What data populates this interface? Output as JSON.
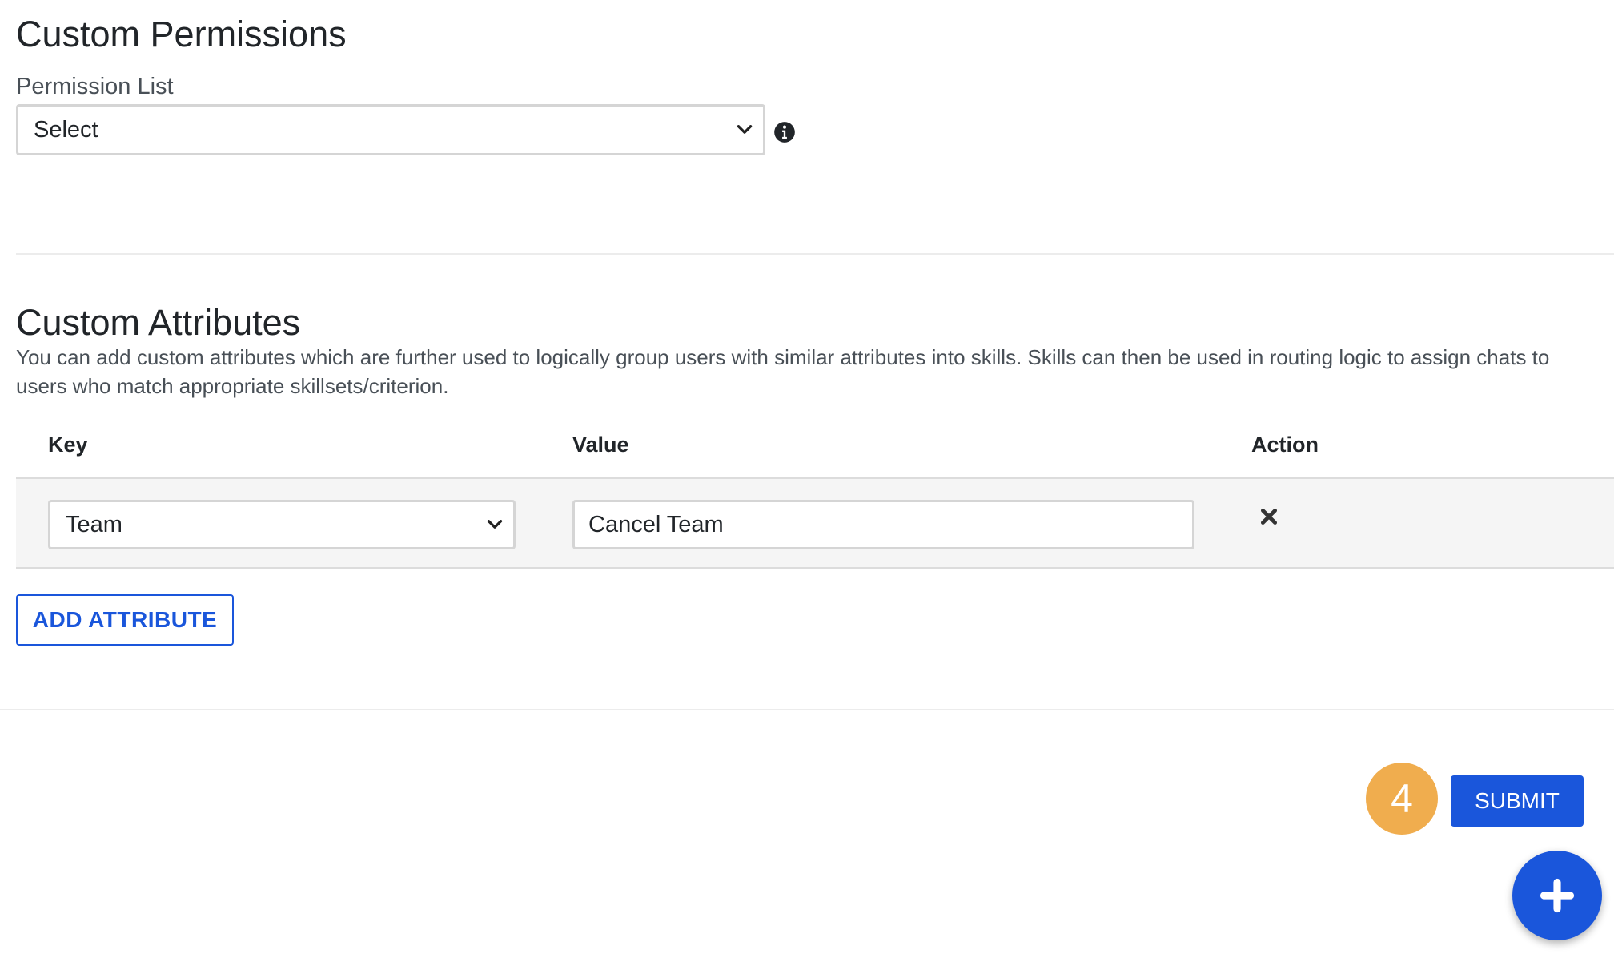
{
  "custom_permissions": {
    "title": "Custom Permissions",
    "permission_list": {
      "label": "Permission List",
      "selected": "Select",
      "info_icon": "info-circle-icon"
    }
  },
  "custom_attributes": {
    "title": "Custom Attributes",
    "description": "You can add custom attributes which are further used to logically group users with similar attributes into skills. Skills can then be used in routing logic to assign chats to users who match appropriate skillsets/criterion.",
    "table": {
      "columns": [
        "Key",
        "Value",
        "Action"
      ],
      "rows": [
        {
          "key": "Team",
          "value": "Cancel Team",
          "action_icon": "close-icon"
        }
      ]
    },
    "add_button_label": "ADD ATTRIBUTE"
  },
  "footer": {
    "step_badge": "4",
    "submit_label": "SUBMIT",
    "fab_icon": "plus-icon"
  },
  "colors": {
    "primary": "#1a56db",
    "badge": "#f0ad4e"
  }
}
